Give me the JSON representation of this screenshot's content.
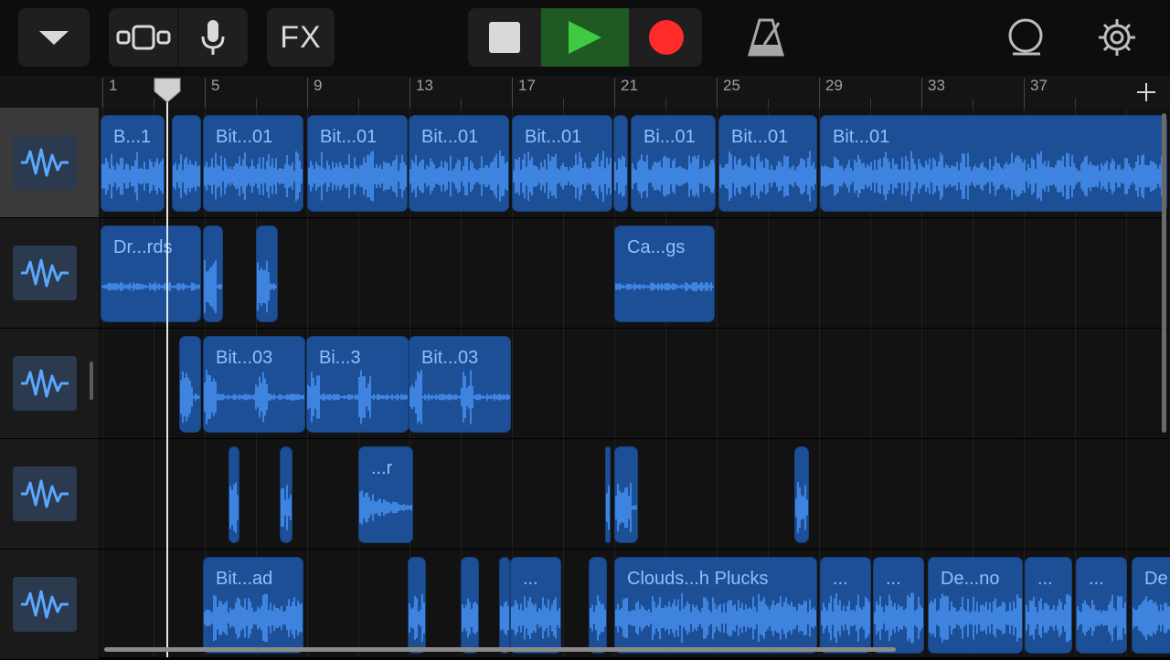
{
  "toolbar": {
    "fx_label": "FX",
    "icons": [
      "chevron-down-icon",
      "view-toggle-icon",
      "microphone-icon",
      "stop-icon",
      "play-icon",
      "record-icon",
      "metronome-icon",
      "loop-icon",
      "settings-icon"
    ],
    "colors": {
      "play_bg": "#1f5a23",
      "play": "#3fcb41",
      "record": "#ff2a2a"
    }
  },
  "ruler": {
    "bars": [
      "1",
      "5",
      "9",
      "13",
      "17",
      "21",
      "25",
      "29",
      "33",
      "37"
    ]
  },
  "colors": {
    "region": "#1d4f96",
    "waveform": "#4d9bff",
    "region_text": "#8fbfff"
  },
  "tracks": [
    {
      "selected": true,
      "regions": [
        {
          "name": "B...1"
        },
        {
          "name": ""
        },
        {
          "name": "Bit...01"
        },
        {
          "name": "Bit...01"
        },
        {
          "name": "Bit...01"
        },
        {
          "name": "Bit...01"
        },
        {
          "name": ""
        },
        {
          "name": "Bi...01"
        },
        {
          "name": "Bit...01"
        },
        {
          "name": "Bit...01"
        }
      ]
    },
    {
      "selected": false,
      "regions": [
        {
          "name": "Dr...rds"
        },
        {
          "name": ""
        },
        {
          "name": ""
        },
        {
          "name": "Ca...gs"
        }
      ]
    },
    {
      "selected": false,
      "regions": [
        {
          "name": ""
        },
        {
          "name": "Bit...03"
        },
        {
          "name": "Bi...3"
        },
        {
          "name": "Bit...03"
        }
      ]
    },
    {
      "selected": false,
      "regions": [
        {
          "name": ""
        },
        {
          "name": ""
        },
        {
          "name": "...r"
        },
        {
          "name": ""
        },
        {
          "name": ""
        },
        {
          "name": ""
        }
      ]
    },
    {
      "selected": false,
      "regions": [
        {
          "name": "Bit...ad"
        },
        {
          "name": ""
        },
        {
          "name": ""
        },
        {
          "name": ""
        },
        {
          "name": "..."
        },
        {
          "name": ""
        },
        {
          "name": "Clouds...h Plucks"
        },
        {
          "name": "..."
        },
        {
          "name": "..."
        },
        {
          "name": "De...no"
        },
        {
          "name": "..."
        },
        {
          "name": "..."
        },
        {
          "name": "De"
        }
      ]
    }
  ]
}
